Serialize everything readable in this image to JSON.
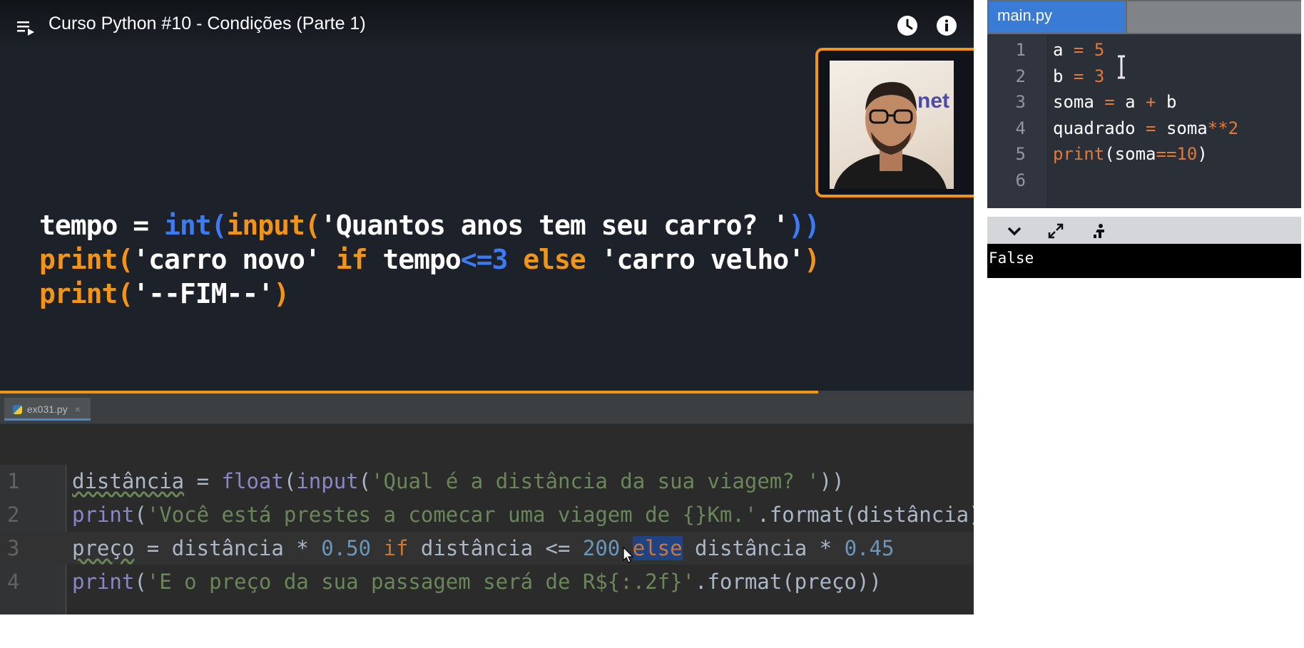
{
  "video": {
    "title": "Curso Python #10 - Condições (Parte 1)",
    "progress_fraction": 0.84,
    "webcam_logo": "net",
    "slide_code": [
      [
        {
          "t": "tempo = ",
          "c": "white"
        },
        {
          "t": "int(",
          "c": "blue"
        },
        {
          "t": "input(",
          "c": "orange"
        },
        {
          "t": "'Quantos anos tem seu carro? '",
          "c": "white"
        },
        {
          "t": "))",
          "c": "blue"
        }
      ],
      [
        {
          "t": "print(",
          "c": "orange"
        },
        {
          "t": "'carro novo' ",
          "c": "white"
        },
        {
          "t": "if ",
          "c": "orange"
        },
        {
          "t": "tempo",
          "c": "white"
        },
        {
          "t": "<=3 ",
          "c": "blue"
        },
        {
          "t": "else ",
          "c": "orange"
        },
        {
          "t": "'carro velho'",
          "c": "white"
        },
        {
          "t": ")",
          "c": "orange"
        }
      ],
      [
        {
          "t": "print(",
          "c": "orange"
        },
        {
          "t": "'--FIM--'",
          "c": "white"
        },
        {
          "t": ")",
          "c": "orange"
        }
      ]
    ]
  },
  "ide": {
    "tab_label": "ex031.py",
    "tab_close": "×",
    "lines": [
      {
        "num": "1",
        "tokens": [
          {
            "t": "distância",
            "c": "sq"
          },
          {
            "t": " = ",
            "c": ""
          },
          {
            "t": "float",
            "c": "bi"
          },
          {
            "t": "(",
            "c": ""
          },
          {
            "t": "input",
            "c": "bi"
          },
          {
            "t": "(",
            "c": ""
          },
          {
            "t": "'Qual é a distância da sua viagem? '",
            "c": "str"
          },
          {
            "t": "))",
            "c": ""
          }
        ]
      },
      {
        "num": "2",
        "tokens": [
          {
            "t": "print",
            "c": "bi"
          },
          {
            "t": "(",
            "c": ""
          },
          {
            "t": "'Você está prestes a comecar uma viagem de {}Km.'",
            "c": "str"
          },
          {
            "t": ".format(distância))",
            "c": ""
          }
        ]
      },
      {
        "num": "3",
        "current": true,
        "tokens": [
          {
            "t": "preço",
            "c": "sq"
          },
          {
            "t": " = distância * ",
            "c": ""
          },
          {
            "t": "0.50",
            "c": "num"
          },
          {
            "t": " ",
            "c": ""
          },
          {
            "t": "if",
            "c": "kw"
          },
          {
            "t": " distância <= ",
            "c": ""
          },
          {
            "t": "200",
            "c": "num"
          },
          {
            "t": " ",
            "c": ""
          },
          {
            "t": "else",
            "c": "kw sel"
          },
          {
            "t": " distância * ",
            "c": ""
          },
          {
            "t": "0.45",
            "c": "num"
          }
        ]
      },
      {
        "num": "4",
        "tokens": [
          {
            "t": "print",
            "c": "bi"
          },
          {
            "t": "(",
            "c": ""
          },
          {
            "t": "'E o preço da sua passagem será de R${:.2f}'",
            "c": "str"
          },
          {
            "t": ".format(preço))",
            "c": ""
          }
        ]
      }
    ]
  },
  "editor": {
    "tab_label": "main.py",
    "lines": [
      {
        "num": "1",
        "tokens": [
          {
            "t": "a ",
            "c": ""
          },
          {
            "t": "=",
            "c": "op"
          },
          {
            "t": " ",
            "c": ""
          },
          {
            "t": "5",
            "c": "num"
          }
        ]
      },
      {
        "num": "2",
        "tokens": [
          {
            "t": "b ",
            "c": ""
          },
          {
            "t": "=",
            "c": "op"
          },
          {
            "t": " ",
            "c": ""
          },
          {
            "t": "3",
            "c": "num"
          }
        ]
      },
      {
        "num": "3",
        "tokens": [
          {
            "t": "soma ",
            "c": ""
          },
          {
            "t": "=",
            "c": "op"
          },
          {
            "t": " a ",
            "c": ""
          },
          {
            "t": "+",
            "c": "op"
          },
          {
            "t": " b",
            "c": ""
          }
        ]
      },
      {
        "num": "4",
        "tokens": [
          {
            "t": "quadrado ",
            "c": ""
          },
          {
            "t": "=",
            "c": "op"
          },
          {
            "t": " soma",
            "c": ""
          },
          {
            "t": "**",
            "c": "op"
          },
          {
            "t": "2",
            "c": "num"
          }
        ]
      },
      {
        "num": "5",
        "tokens": [
          {
            "t": "print",
            "c": "fn"
          },
          {
            "t": "(soma",
            "c": ""
          },
          {
            "t": "==",
            "c": "op"
          },
          {
            "t": "10",
            "c": "num"
          },
          {
            "t": ")",
            "c": ""
          }
        ]
      },
      {
        "num": "6",
        "tokens": []
      }
    ],
    "output": "False"
  },
  "colors": {
    "accent_orange": "#f29418",
    "accent_blue": "#3d7bf2",
    "editor_tab_blue": "#3a7bd5"
  },
  "icons": [
    "playlist-icon",
    "clock-icon",
    "info-icon",
    "python-file-icon",
    "chevron-down-icon",
    "expand-icon",
    "run-icon"
  ]
}
